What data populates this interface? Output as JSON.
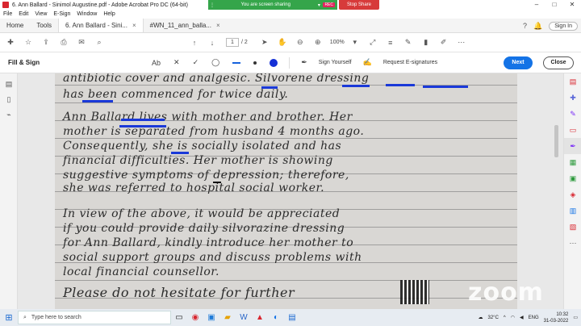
{
  "window": {
    "title": "6. Ann Ballard - Sinimol Augustine.pdf - Adobe Acrobat Pro DC (64-bit)",
    "controls": [
      "–",
      "□",
      "✕"
    ]
  },
  "share": {
    "status": "You are screen sharing",
    "rec_badge": "REC",
    "stop_label": "Stop Share"
  },
  "menu": [
    "File",
    "Edit",
    "View",
    "E-Sign",
    "Window",
    "Help"
  ],
  "tabs": {
    "home": "Home",
    "tools": "Tools",
    "doc1": "6. Ann Ballard - Sini...",
    "doc2": "#WN_11_ann_balla...",
    "close": "×",
    "signin": "Sign In"
  },
  "toolbar": {
    "page_current": "1",
    "page_total": "/ 2",
    "zoom": "100%"
  },
  "fillsign": {
    "title": "Fill & Sign",
    "text_tool": "Ab",
    "sign_yourself": "Sign Yourself",
    "request": "Request E-signatures",
    "next": "Next",
    "close": "Close",
    "accent_color": "#1473e6",
    "ink_color": "#1430d6"
  },
  "document": {
    "lines": [
      "antibiotic cover and analgesic. Silvorene dressing",
      "has been commenced for twice daily.",
      "Ann Ballard lives with mother and brother. Her",
      "mother is separated from husband 4 months ago.",
      "Consequently, she is socially isolated and has",
      "financial difficulties. Her mother is showing",
      "suggestive symptoms of depression; therefore,",
      "she was referred to hospital social worker.",
      "In view of the above, it would be appreciated",
      "if you could provide daily silvorazine dressing",
      "for Ann Ballard, kindly introduce her mother to",
      "social support groups and discuss problems with",
      "local financial counsellor.",
      "Please do not hesitate for further"
    ]
  },
  "watermark": "zoom",
  "taskbar": {
    "search_placeholder": "Type here to search",
    "weather": "32°C",
    "lang": "ENG",
    "time": "10:32",
    "date": "31-03-2022"
  }
}
